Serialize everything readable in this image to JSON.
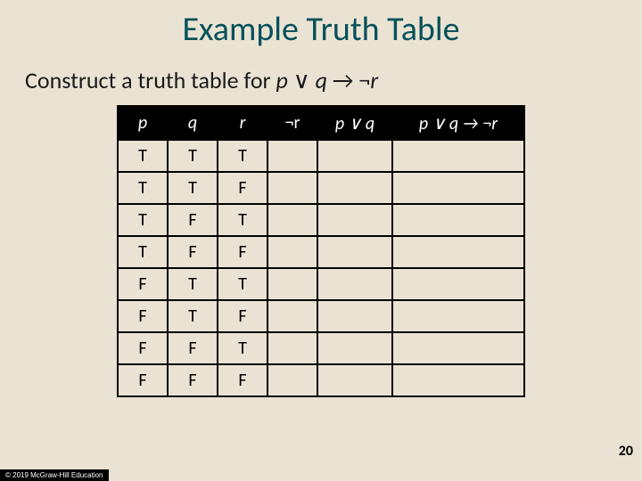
{
  "title": "Example Truth Table",
  "prompt": {
    "prefix": "Construct a truth table for ",
    "expr_p": "p",
    "expr_or": " ∨ ",
    "expr_q": "q",
    "expr_impl": " → ¬",
    "expr_r": "r"
  },
  "headers": {
    "p": "p",
    "q": "q",
    "r": "r",
    "notr": "¬r",
    "pvq": "p ∨ q",
    "impl": "p ∨ q → ¬r"
  },
  "rows": [
    {
      "p": "T",
      "q": "T",
      "r": "T",
      "notr": "",
      "pvq": "",
      "impl": ""
    },
    {
      "p": "T",
      "q": "T",
      "r": "F",
      "notr": "",
      "pvq": "",
      "impl": ""
    },
    {
      "p": "T",
      "q": "F",
      "r": "T",
      "notr": "",
      "pvq": "",
      "impl": ""
    },
    {
      "p": "T",
      "q": "F",
      "r": "F",
      "notr": "",
      "pvq": "",
      "impl": ""
    },
    {
      "p": "F",
      "q": "T",
      "r": "T",
      "notr": "",
      "pvq": "",
      "impl": ""
    },
    {
      "p": "F",
      "q": "T",
      "r": "F",
      "notr": "",
      "pvq": "",
      "impl": ""
    },
    {
      "p": "F",
      "q": "F",
      "r": "T",
      "notr": "",
      "pvq": "",
      "impl": ""
    },
    {
      "p": "F",
      "q": "F",
      "r": "F",
      "notr": "",
      "pvq": "",
      "impl": ""
    }
  ],
  "page_number": "20",
  "copyright": "© 2019 McGraw-Hill Education"
}
